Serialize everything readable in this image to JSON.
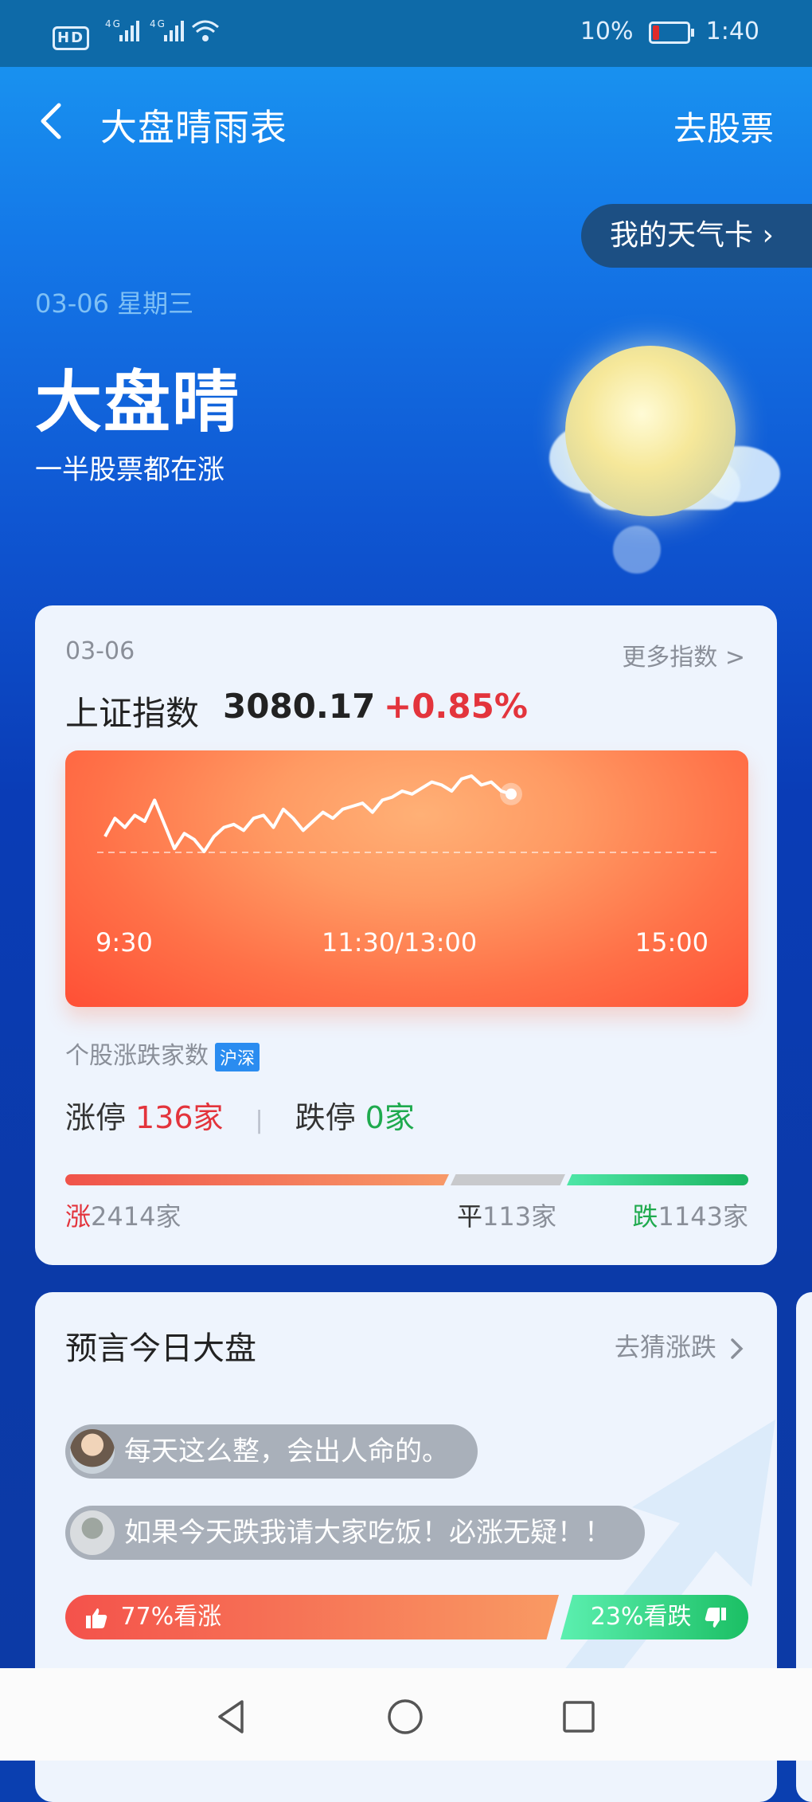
{
  "status_bar": {
    "left": "4G 4G",
    "hd": "HD",
    "battery": "10%",
    "time": "1:40"
  },
  "header": {
    "title": "大盘晴雨表",
    "right_link": "去股票"
  },
  "weather_card_button": "我的天气卡 ›",
  "hero": {
    "date": "03-06  星期三",
    "headline": "大盘晴",
    "subline": "一半股票都在涨",
    "icon": "sun-cloud-icon"
  },
  "index_card": {
    "date": "03-06",
    "more_link": "更多指数 >",
    "index_name": "上证指数",
    "index_value": "3080.17",
    "index_change": "+0.85%",
    "chart_data": {
      "type": "line",
      "x_ticks": [
        "9:30",
        "11:30/13:00",
        "15:00"
      ],
      "baseline": "dashed previous close",
      "values": [
        0.0,
        0.6,
        0.3,
        0.7,
        0.5,
        1.2,
        0.4,
        -0.4,
        0.1,
        -0.1,
        -0.5,
        0.0,
        0.3,
        0.4,
        0.2,
        0.6,
        0.7,
        0.3,
        0.9,
        0.6,
        0.2,
        0.5,
        0.8,
        0.6,
        0.9,
        1.0,
        1.1,
        0.8,
        1.2,
        1.3,
        1.5,
        1.4,
        1.6,
        1.8,
        1.7,
        1.5,
        1.9,
        2.0,
        1.7,
        1.8,
        1.5,
        1.4
      ],
      "color": "#ffffff"
    },
    "stats_title": "个股涨跌家数",
    "stats_badge": "沪深",
    "limit_up_label": "涨停",
    "limit_up_value": "136家",
    "separator": "|",
    "limit_down_label": "跌停",
    "limit_down_value": "0家",
    "distribution": {
      "up_key": "涨",
      "up_value": "2414家",
      "flat_key": "平",
      "flat_value": "113家",
      "down_key": "跌",
      "down_value": "1143家",
      "up_count": 2414,
      "flat_count": 113,
      "down_count": 1143
    }
  },
  "predict_card": {
    "title": "预言今日大盘",
    "guess_link": "去猜涨跌",
    "comments": [
      {
        "text": "每天这么整，会出人命的。",
        "avatar": "avatar"
      },
      {
        "text": "如果今天跌我请大家吃饭！必涨无疑！！",
        "avatar": "avatar"
      }
    ],
    "vote_up": "77%看涨",
    "vote_down": "23%看跌",
    "vote_up_share": 0.77
  },
  "nav_bar": {
    "back": "back-triangle-icon",
    "home": "home-circle-icon",
    "recent": "recent-square-icon"
  },
  "colors": {
    "up": "#e3343c",
    "down": "#1faa4e",
    "accent": "#1478e8"
  }
}
